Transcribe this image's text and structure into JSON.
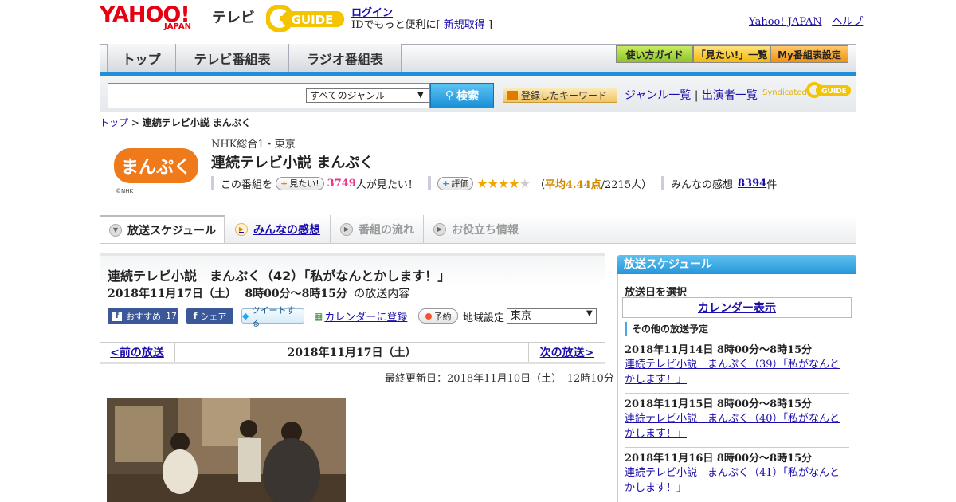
{
  "header": {
    "logo_yahoo": "YAHOO!",
    "logo_japan": "JAPAN",
    "logo_tv": "テレビ",
    "logo_gguide": "GUIDE",
    "login": "ログイン",
    "login_sub_prefix": "IDでもっと便利に[",
    "signup": "新規取得",
    "login_sub_suffix": "]",
    "yahoo_japan": "Yahoo! JAPAN",
    "separator": "-",
    "help": "ヘルプ"
  },
  "nav": {
    "tabs": [
      "トップ",
      "テレビ番組表",
      "ラジオ番組表"
    ],
    "util_buttons": [
      "使い方ガイド",
      "「見たい!」一覧",
      "My番組表設定"
    ]
  },
  "search": {
    "genre_selected": "すべてのジャンル",
    "button": "検索",
    "keyword_button": "登録したキーワード",
    "genre_list": "ジャンル一覧",
    "divider": "|",
    "performer_list": "出演者一覧",
    "syndicated": "Syndicated"
  },
  "breadcrumb": {
    "home": "トップ",
    "sep": ">",
    "current": "連続テレビ小説 まんぷく"
  },
  "program": {
    "logo_text": "まんぷく",
    "logo_copyright": "©NHK",
    "channel": "NHK総合1・東京",
    "title": "連続テレビ小説 まんぷく",
    "want_prefix": "この番組を",
    "want_button": "見たい!",
    "want_count": "3749",
    "want_suffix": "人が見たい！",
    "rate_button": "評価",
    "stars_filled": "★★★★",
    "stars_empty": "★",
    "avg_open": "（",
    "avg_label": "平均4.44点",
    "avg_suffix": "/2215人）",
    "impressions_label": "みんなの感想",
    "impressions_count": "8394",
    "impressions_unit": "件"
  },
  "program_tabs": [
    "放送スケジュール",
    "みんなの感想",
    "番組の流れ",
    "お役立ち情報"
  ],
  "episode": {
    "title": "連続テレビ小説　まんぷく（42）「私がなんとかします！」",
    "date": "2018年11月17日（土）",
    "time": "8時00分～8時15分",
    "suffix": "の放送内容",
    "fb_recommend": "おすすめ",
    "fb_count": "17",
    "fb_share": "シェア",
    "tweet": "ツイートする",
    "calendar_register": "カレンダーに登録",
    "reserve": "予約",
    "region_label": "地域設定",
    "region_value": "東京"
  },
  "pager": {
    "prev": "<前の放送",
    "current": "2018年11月17日（土）",
    "next": "次の放送>"
  },
  "updated": "最終更新日：2018年11月10日（土）　12時10分",
  "sidebar": {
    "header": "放送スケジュール",
    "select_label": "放送日を選択",
    "calendar_link": "カレンダー表示",
    "other_header": "その他の放送予定",
    "schedule": [
      {
        "datetime": "2018年11月14日  8時00分～8時15分",
        "title_line1": "連続テレビ小説　まんぷく（39）「私がなんと",
        "title_line2": "かします！」"
      },
      {
        "datetime": "2018年11月15日  8時00分～8時15分",
        "title_line1": "連続テレビ小説　まんぷく（40）「私がなんと",
        "title_line2": "かします！」"
      },
      {
        "datetime": "2018年11月16日  8時00分～8時15分",
        "title_line1": "連続テレビ小説　まんぷく（41）「私がなんと",
        "title_line2": "かします！」"
      }
    ]
  },
  "colors": {
    "accent_blue": "#1e8fd8",
    "yahoo_red": "#e60012",
    "gguide_yellow": "#f5c400",
    "manpuku_orange": "#ee7a1c",
    "want_pink": "#e8358c",
    "facebook": "#3b5998"
  }
}
